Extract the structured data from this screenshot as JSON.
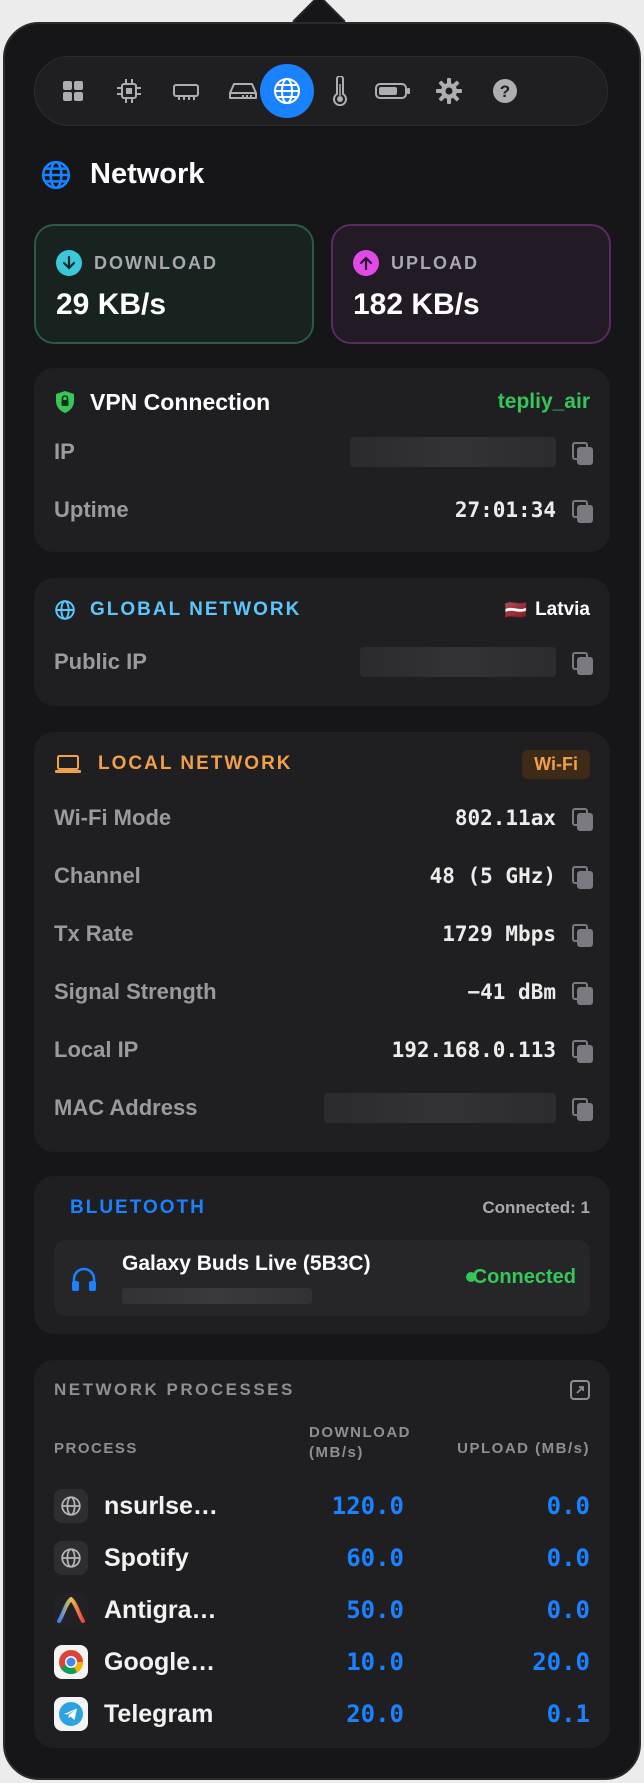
{
  "toolbar": {
    "items": [
      {
        "icon": "dashboard-grid-icon",
        "active": false
      },
      {
        "icon": "cpu-chip-icon",
        "active": false
      },
      {
        "icon": "memory-ram-icon",
        "active": false
      },
      {
        "icon": "disk-drive-icon",
        "active": false
      },
      {
        "icon": "globe-network-icon",
        "active": true
      },
      {
        "icon": "thermometer-icon",
        "active": false
      },
      {
        "icon": "battery-icon",
        "active": false
      },
      {
        "icon": "gear-settings-icon",
        "active": false
      },
      {
        "icon": "help-question-icon",
        "active": false
      }
    ]
  },
  "header": {
    "title": "Network"
  },
  "download": {
    "label": "DOWNLOAD",
    "value": "29 KB/s"
  },
  "upload": {
    "label": "UPLOAD",
    "value": "182 KB/s"
  },
  "vpn": {
    "title": "VPN Connection",
    "name": "tepliy_air",
    "ip_label": "IP",
    "uptime_label": "Uptime",
    "uptime_value": "27:01:34"
  },
  "global": {
    "title": "GLOBAL NETWORK",
    "country_flag": "🇱🇻",
    "country": "Latvia",
    "public_ip_label": "Public IP"
  },
  "local": {
    "title": "LOCAL NETWORK",
    "badge": "Wi-Fi",
    "rows": [
      {
        "label": "Wi-Fi Mode",
        "value": "802.11ax"
      },
      {
        "label": "Channel",
        "value": "48 (5 GHz)"
      },
      {
        "label": "Tx Rate",
        "value": "1729 Mbps"
      },
      {
        "label": "Signal Strength",
        "value": "−41 dBm"
      },
      {
        "label": "Local IP",
        "value": "192.168.0.113"
      },
      {
        "label": "MAC Address",
        "value": ""
      }
    ]
  },
  "bluetooth": {
    "title": "BLUETOOTH",
    "connected_count": "Connected: 1",
    "device_name": "Galaxy Buds Live (5B3C)",
    "device_status": "Connected"
  },
  "processes": {
    "title": "NETWORK PROCESSES",
    "col_process": "PROCESS",
    "col_download_1": "DOWNLOAD",
    "col_download_2": "(MB/s)",
    "col_upload": "UPLOAD (MB/s)",
    "rows": [
      {
        "name": "nsurlse…",
        "download": "120.0",
        "upload": "0.0",
        "icon": "system-globe-icon"
      },
      {
        "name": "Spotify",
        "download": "60.0",
        "upload": "0.0",
        "icon": "system-globe-icon"
      },
      {
        "name": "Antigra…",
        "download": "50.0",
        "upload": "0.0",
        "icon": "antigravity-app-icon"
      },
      {
        "name": "Google…",
        "download": "10.0",
        "upload": "20.0",
        "icon": "chrome-app-icon"
      },
      {
        "name": "Telegram",
        "download": "20.0",
        "upload": "0.1",
        "icon": "telegram-app-icon"
      }
    ]
  },
  "colors": {
    "accent": "#1a82ff",
    "download_border": "#2b5a48",
    "upload_border": "#5a2b63",
    "vpn_name": "#35c759",
    "global_title": "#5ac8fa",
    "local_title": "#f0a04b",
    "bluetooth_title": "#1a82ff",
    "connected": "#35c759"
  }
}
